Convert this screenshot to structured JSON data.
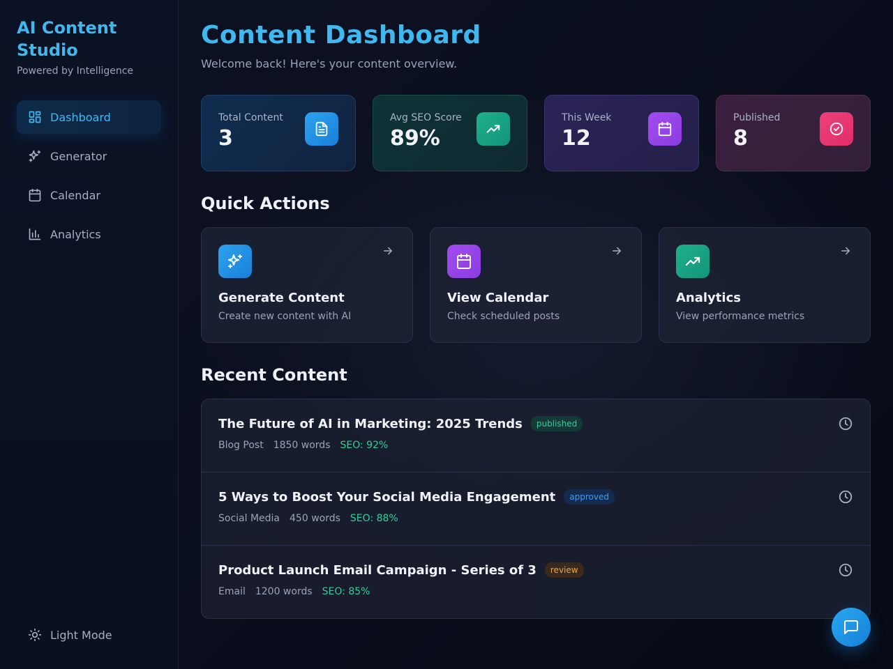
{
  "brand": {
    "title": "AI Content Studio",
    "subtitle": "Powered by Intelligence"
  },
  "nav": [
    {
      "label": "Dashboard",
      "icon": "dashboard-icon",
      "active": true
    },
    {
      "label": "Generator",
      "icon": "sparkles-icon"
    },
    {
      "label": "Calendar",
      "icon": "calendar-icon"
    },
    {
      "label": "Analytics",
      "icon": "bar-chart-icon"
    }
  ],
  "theme_toggle": {
    "label": "Light Mode",
    "icon": "sun-icon"
  },
  "header": {
    "title": "Content Dashboard",
    "subtitle": "Welcome back! Here's your content overview."
  },
  "stats": [
    {
      "label": "Total Content",
      "value": "3",
      "icon": "document-icon",
      "color": "#1a8ee6"
    },
    {
      "label": "Avg SEO Score",
      "value": "89%",
      "icon": "trending-up-icon",
      "color": "#16a484"
    },
    {
      "label": "This Week",
      "value": "12",
      "icon": "calendar-icon",
      "color": "#9444e8"
    },
    {
      "label": "Published",
      "value": "8",
      "icon": "check-circle-icon",
      "color": "#e83874"
    }
  ],
  "quick_actions": {
    "title": "Quick Actions",
    "items": [
      {
        "title": "Generate Content",
        "description": "Create new content with AI",
        "icon": "sparkles-icon"
      },
      {
        "title": "View Calendar",
        "description": "Check scheduled posts",
        "icon": "calendar-icon"
      },
      {
        "title": "Analytics",
        "description": "View performance metrics",
        "icon": "trending-up-icon"
      }
    ]
  },
  "recent": {
    "title": "Recent Content",
    "items": [
      {
        "title": "The Future of AI in Marketing: 2025 Trends",
        "status": "published",
        "type": "Blog Post",
        "words": "1850 words",
        "seo": "SEO: 92%"
      },
      {
        "title": "5 Ways to Boost Your Social Media Engagement",
        "status": "approved",
        "type": "Social Media",
        "words": "450 words",
        "seo": "SEO: 88%"
      },
      {
        "title": "Product Launch Email Campaign - Series of 3",
        "status": "review",
        "type": "Email",
        "words": "1200 words",
        "seo": "SEO: 85%"
      }
    ]
  },
  "colors": {
    "accent": "#3fb8f0",
    "success": "#2fcf9a",
    "warning": "#f0a53f",
    "info": "#3f9df0"
  }
}
